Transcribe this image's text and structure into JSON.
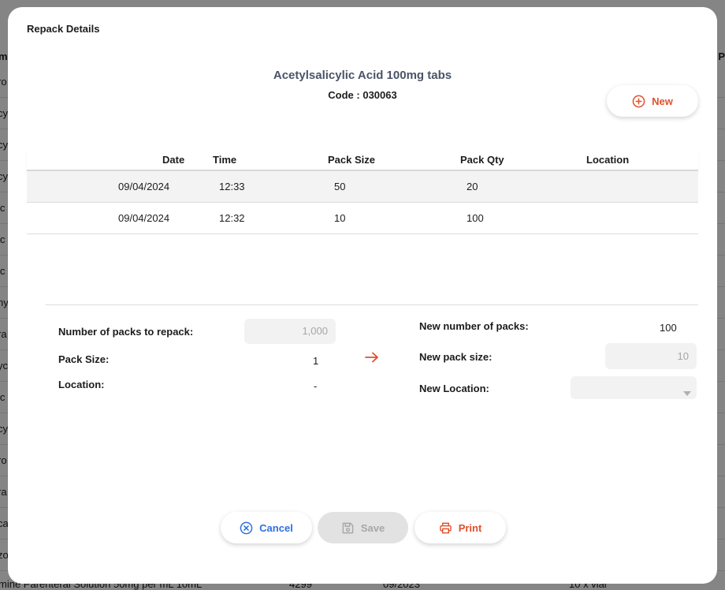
{
  "background": {
    "header_left": "me",
    "header_right": "P",
    "row_fragments": [
      "ro",
      "cy",
      "cy",
      "cy",
      "ic",
      "ic",
      "ic",
      "ny",
      "ra",
      "yc",
      "ic",
      "cy",
      "ro",
      "ra",
      "ca",
      "zo"
    ],
    "bottom_row": [
      "mine Parenteral Solution 50mg per mL 10mL",
      "4299",
      "09/2023",
      "10 x vial"
    ]
  },
  "modal": {
    "title": "Repack Details",
    "product_name": "Acetylsalicylic Acid 100mg tabs",
    "product_code": "Code : 030063",
    "new_button": "New"
  },
  "history": {
    "columns": [
      "Date",
      "Time",
      "Pack Size",
      "Pack Qty",
      "Location"
    ],
    "rows": [
      {
        "date": "09/04/2024",
        "time": "12:33",
        "pack_size": "50",
        "pack_qty": "20",
        "location": ""
      },
      {
        "date": "09/04/2024",
        "time": "12:32",
        "pack_size": "10",
        "pack_qty": "100",
        "location": ""
      }
    ]
  },
  "form": {
    "packs_to_repack_label": "Number of packs to repack:",
    "packs_to_repack_value": "1,000",
    "pack_size_label": "Pack Size:",
    "pack_size_value": "1",
    "location_label": "Location:",
    "location_value": "-",
    "new_packs_label": "New number of packs:",
    "new_packs_value": "100",
    "new_pack_size_label": "New pack size:",
    "new_pack_size_value": "10",
    "new_location_label": "New Location:",
    "new_location_value": ""
  },
  "footer": {
    "cancel": "Cancel",
    "save": "Save",
    "print": "Print"
  },
  "colors": {
    "accent_orange": "#e0502c",
    "accent_blue": "#2f6fe0",
    "disabled_gray": "#e2e2e2",
    "product_title": "#4a5468"
  }
}
